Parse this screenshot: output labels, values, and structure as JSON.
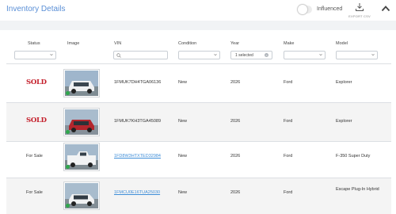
{
  "header": {
    "title": "Inventory Details",
    "toggle_label": "Influenced",
    "export_label": "EXPORT CSV"
  },
  "columns": [
    "Status",
    "Image",
    "VIN",
    "Condition",
    "Year",
    "Make",
    "Model"
  ],
  "filters": {
    "year_selected": "1 selected"
  },
  "rows": [
    {
      "status": "SOLD",
      "vin": "1FMUK7DH4TGA06136",
      "vin_is_link": false,
      "condition": "New",
      "year": "2026",
      "make": "Ford",
      "model": "Explorer",
      "vehicle_color": "#eef0f2"
    },
    {
      "status": "SOLD",
      "vin": "1FMUK7KH3TGA45089",
      "vin_is_link": false,
      "condition": "New",
      "year": "2026",
      "make": "Ford",
      "model": "Explorer",
      "vehicle_color": "#b3262d"
    },
    {
      "status": "For Sale",
      "vin": "1FD8W3HTXTED32984",
      "vin_is_link": true,
      "condition": "New",
      "year": "2026",
      "make": "Ford",
      "model": "F-350 Super Duty",
      "vehicle_color": "#f2f3f4"
    },
    {
      "status": "For Sale",
      "vin": "1FMCU0E16TUA25030",
      "vin_is_link": true,
      "condition": "New",
      "year": "2026",
      "make": "Ford",
      "model": "Escape Plug-In Hybrid",
      "vehicle_color": "#f0f1f2"
    }
  ],
  "colors": {
    "title": "#5a8fd6",
    "sold": "#c41e2a",
    "link": "#3f8ed8",
    "badge": "#2ea84b"
  }
}
